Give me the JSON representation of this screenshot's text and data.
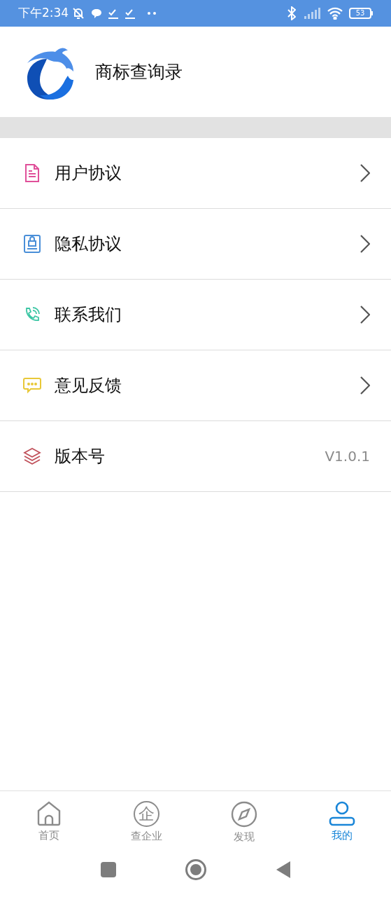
{
  "status_bar": {
    "time": "下午2:34",
    "battery": "53"
  },
  "header": {
    "title": "商标查询录"
  },
  "menu": [
    {
      "label": "用户协议",
      "kind": "link",
      "color": "#e0509a"
    },
    {
      "label": "隐私协议",
      "kind": "link",
      "color": "#4a8fd8"
    },
    {
      "label": "联系我们",
      "kind": "link",
      "color": "#3cc6a4"
    },
    {
      "label": "意见反馈",
      "kind": "link",
      "color": "#e8c838"
    },
    {
      "label": "版本号",
      "kind": "value",
      "value": "V1.0.1",
      "color": "#c0505a"
    }
  ],
  "tab_bar": [
    {
      "label": "首页",
      "selected": false
    },
    {
      "label": "查企业",
      "selected": false,
      "icon_text": "企"
    },
    {
      "label": "发现",
      "selected": false
    },
    {
      "label": "我的",
      "selected": true
    }
  ]
}
